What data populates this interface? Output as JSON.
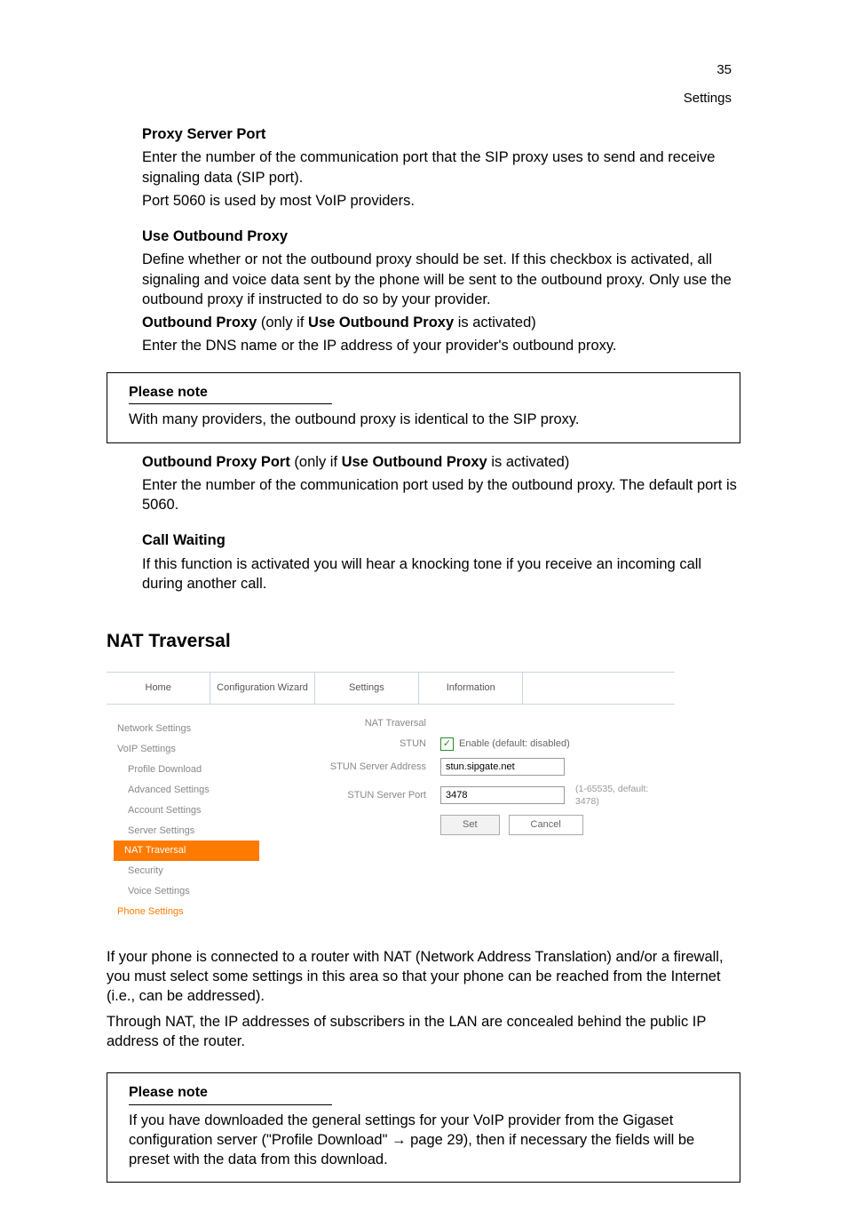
{
  "pageno": "35",
  "section_head": "Settings",
  "p1_label": "Proxy Server Port",
  "p1a": "Enter the number of the communication port that the SIP proxy uses to send and receive signaling data (SIP port).",
  "p1b": "Port 5060 is used by most VoIP providers.",
  "p2_label": "Use Outbound Proxy",
  "p2a": "Define whether or not the outbound proxy should be set. If this checkbox is activated, all signaling and voice data sent by the phone will be sent to the outbound proxy. Only use the outbound proxy if instructed to do so by your provider.",
  "p3_label": "Outbound Proxy",
  "p3_only_if": " (only if ",
  "p3_ref": "Use Outbound Proxy",
  "p3_tail": " is activated)",
  "p3_body": "Enter the DNS name or the IP address of your provider's outbound proxy.",
  "note1_label": "Please note",
  "note1_text": "With many providers, the outbound proxy is identical to the SIP proxy.",
  "p4_label": "Outbound Proxy Port",
  "p4_only_if": " (only if ",
  "p4_ref": "Use Outbound Proxy",
  "p4_tail": " is activated)",
  "p4a": "Enter the number of the communication port used by the outbound proxy. The default port is 5060.",
  "p5_label": "Call Waiting",
  "p5a": "If this function is activated you will hear a knocking tone if you receive an incoming call during another call.",
  "h2": "NAT Traversal",
  "ss": {
    "tabs": [
      "Home",
      "Configuration Wizard",
      "Settings",
      "Information",
      ""
    ],
    "sidebar_top": [
      "Network Settings",
      "VoIP Settings"
    ],
    "sidebar_sub": [
      "Profile Download",
      "Advanced Settings",
      "Account Settings",
      "Server Settings",
      "NAT Traversal",
      "Security",
      "Voice Settings"
    ],
    "sidebar_active": "NAT Traversal",
    "sidebar_bottom": [
      "Phone Settings"
    ],
    "form_title": "NAT Traversal",
    "stun_label": "STUN",
    "stun_enable": "Enable (default: disabled)",
    "stun_addr_label": "STUN Server Address",
    "stun_addr_value": "stun.sipgate.net",
    "stun_port_label": "STUN Server Port",
    "stun_port_value": "3478",
    "stun_port_hint": "(1-65535, default: 3478)",
    "btn_set": "Set",
    "btn_cancel": "Cancel"
  },
  "after1": "If your phone is connected to a router with NAT (Network Address Translation) and/or a firewall, you must select some settings in this area so that your phone can be reached from the Internet (i.e., can be addressed).",
  "after2": "Through NAT, the IP addresses of subscribers in the LAN are concealed behind the public IP address of the router.",
  "note2_label": "Please note",
  "note2_a": "If you have downloaded the general settings for your VoIP provider from the Gigaset configuration server (\"Profile Download\" ",
  "note2_arrow": "→",
  "note2_b": " page 29), then if necessary the fields will be preset with the data from this download."
}
